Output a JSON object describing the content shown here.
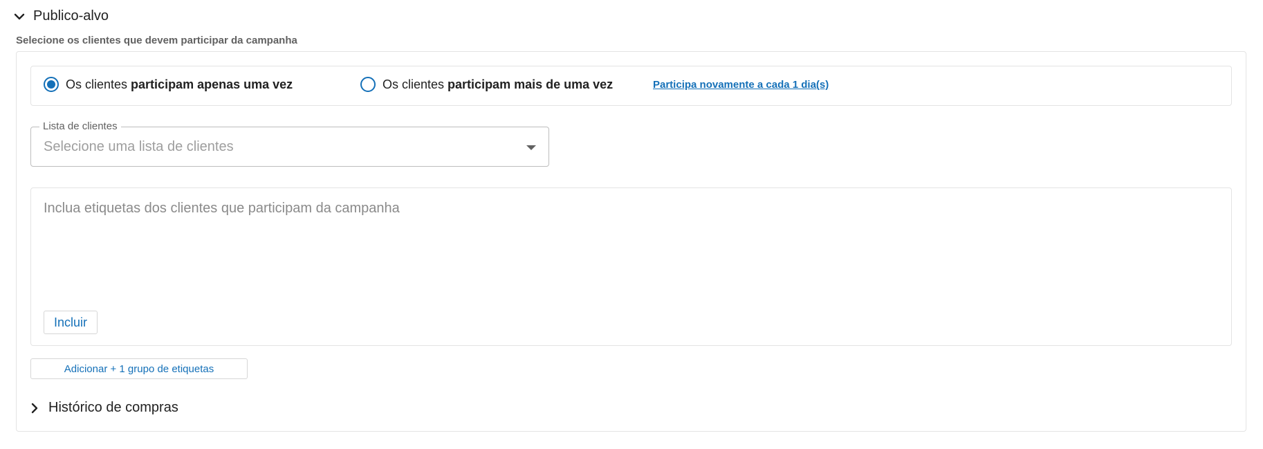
{
  "section": {
    "title": "Publico-alvo",
    "subtitle": "Selecione os clientes que devem participar da campanha"
  },
  "participation": {
    "option_once": {
      "prefix": "Os clientes ",
      "bold": "participam apenas uma vez",
      "selected": true
    },
    "option_multiple": {
      "prefix": "Os clientes ",
      "bold": "participam mais de uma vez",
      "selected": false
    },
    "repeat_link": "Participa novamente a cada 1 dia(s)"
  },
  "client_list": {
    "label": "Lista de clientes",
    "placeholder": "Selecione uma lista de clientes"
  },
  "tags": {
    "placeholder": "Inclua etiquetas dos clientes que participam da campanha",
    "include_label": "Incluir"
  },
  "add_group_label": "Adicionar + 1 grupo de etiquetas",
  "history": {
    "title": "Histórico de compras"
  },
  "colors": {
    "accent": "#1470b8",
    "border": "#e3e3e3",
    "muted_text": "#616161",
    "placeholder_text": "#9e9e9e"
  },
  "icons": {
    "section_toggle": "chevron-down-icon",
    "history_toggle": "chevron-right-icon",
    "select_caret": "caret-down-icon"
  }
}
